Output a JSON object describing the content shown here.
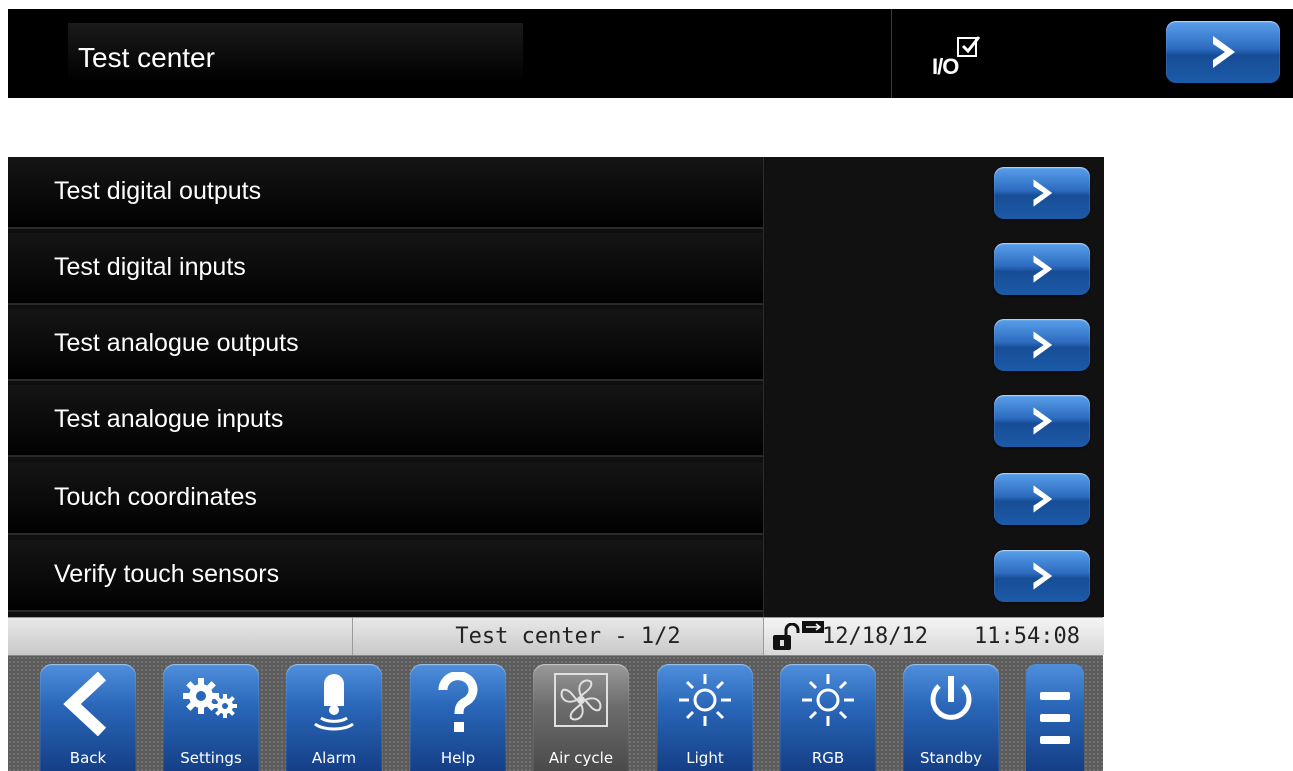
{
  "header": {
    "title": "Test center",
    "io_label": "I/O",
    "io_checked": true
  },
  "list": {
    "items": [
      {
        "label": "Test digital outputs"
      },
      {
        "label": "Test digital inputs"
      },
      {
        "label": "Test analogue outputs"
      },
      {
        "label": "Test analogue inputs"
      },
      {
        "label": "Touch coordinates"
      },
      {
        "label": "Verify touch sensors"
      }
    ]
  },
  "status": {
    "page": "Test center - 1/2",
    "date": "12/18/12",
    "time": "11:54:08"
  },
  "toolbar": {
    "buttons": [
      {
        "label": "Back",
        "icon": "back-arrow-icon"
      },
      {
        "label": "Settings",
        "icon": "gears-icon"
      },
      {
        "label": "Alarm",
        "icon": "bell-icon"
      },
      {
        "label": "Help",
        "icon": "question-icon"
      },
      {
        "label": "Air cycle",
        "icon": "fan-icon"
      },
      {
        "label": "Light",
        "icon": "sun-icon"
      },
      {
        "label": "RGB",
        "icon": "sun-icon"
      },
      {
        "label": "Standby",
        "icon": "power-icon"
      }
    ],
    "menu_icon": "menu-icon"
  },
  "colors": {
    "button_blue": "#2c6bbf",
    "air_cycle_gray": "#6c6c6c",
    "background": "#000000"
  }
}
